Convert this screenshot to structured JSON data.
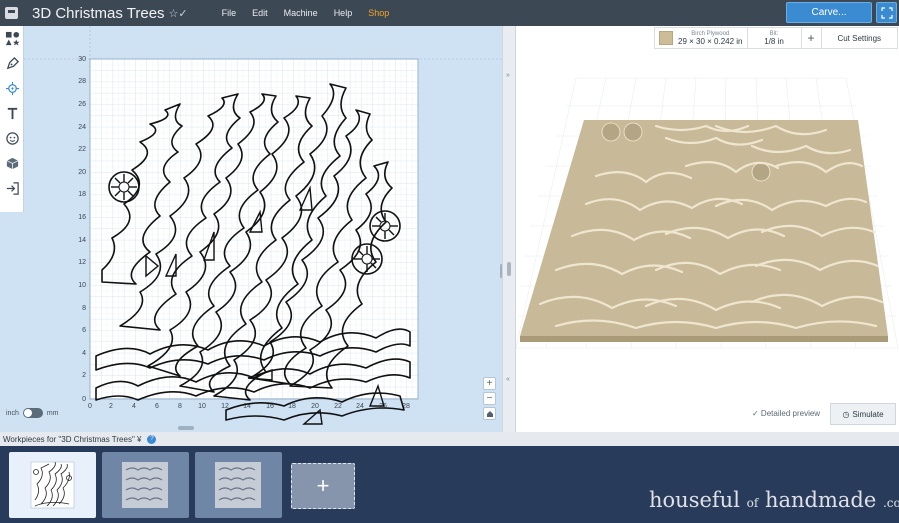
{
  "app": {
    "project_title": "3D Christmas Trees",
    "title_icons": "☆✓",
    "menu": [
      {
        "label": "File"
      },
      {
        "label": "Edit"
      },
      {
        "label": "Machine"
      },
      {
        "label": "Help"
      },
      {
        "label": "Shop"
      }
    ],
    "carve_label": "Carve...",
    "accent_color": "#3a8bd1",
    "shop_color": "#f5a623"
  },
  "toolbar": {
    "tools": [
      "shapes-icon",
      "pen-icon",
      "target-icon",
      "text-icon",
      "emoji-icon",
      "box-icon",
      "import-icon"
    ]
  },
  "canvas": {
    "y_ticks": [
      "30",
      "28",
      "26",
      "24",
      "22",
      "20",
      "18",
      "16",
      "14",
      "12",
      "10",
      "8",
      "6",
      "4",
      "2",
      "0"
    ],
    "x_ticks": [
      "0",
      "2",
      "4",
      "6",
      "8",
      "10",
      "12",
      "14",
      "16",
      "18",
      "20",
      "22",
      "24",
      "26",
      "28"
    ],
    "unit_inch": "inch",
    "unit_mm": "mm",
    "zoom_in": "+",
    "zoom_out": "−"
  },
  "divider": {
    "left_arrow": "»",
    "right_arrow": "«"
  },
  "material": {
    "name": "Birch Plywood",
    "size": "29 × 30 × 0.242 in",
    "bit_label": "Bit:",
    "bit_value": "1/8 in",
    "add": "+",
    "cut_settings": "Cut Settings"
  },
  "preview": {
    "detailed_preview": "✓ Detailed preview",
    "simulate": "Simulate"
  },
  "workpieces": {
    "header": "Workpieces for \"3D Christmas Trees\" ¥",
    "help": "?",
    "add": "+"
  },
  "watermark": {
    "part1": "houseful",
    "part2": "of",
    "part3": "handmade",
    "part4": ".com"
  }
}
